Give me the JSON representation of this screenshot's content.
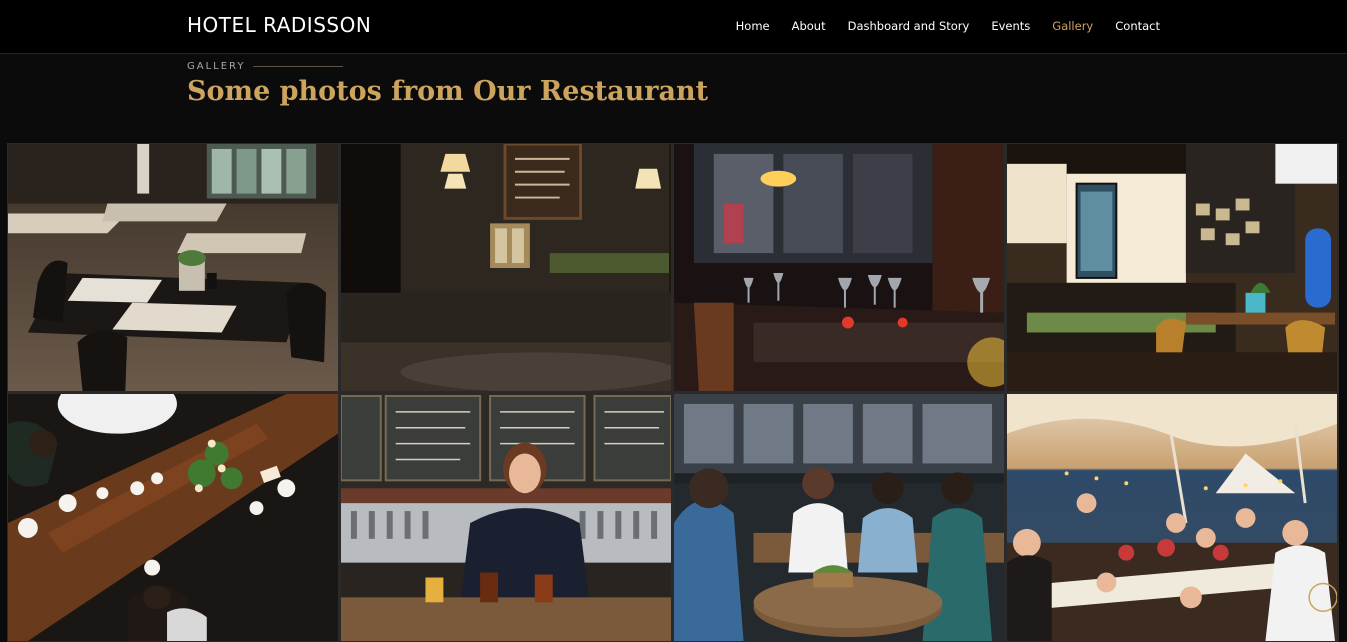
{
  "header": {
    "brand": "HOTEL RADISSON",
    "nav": [
      {
        "label": "Home"
      },
      {
        "label": "About"
      },
      {
        "label": "Dashboard and Story"
      },
      {
        "label": "Events"
      },
      {
        "label": "Gallery"
      },
      {
        "label": "Contact"
      }
    ],
    "active_nav": "Gallery"
  },
  "gallery": {
    "section_label": "GALLERY",
    "title": "Some photos from Our Restaurant",
    "photos": [
      {
        "subject": "empty restaurant tables"
      },
      {
        "subject": "dim bar interior with menu board"
      },
      {
        "subject": "wine glasses on tables at night"
      },
      {
        "subject": "cafe counter with drinks fridge"
      },
      {
        "subject": "overhead wooden dinner table"
      },
      {
        "subject": "smiling woman at beer taps"
      },
      {
        "subject": "friends laughing on patio"
      },
      {
        "subject": "toast under festival tent"
      }
    ]
  },
  "colors": {
    "accent": "#cda45e",
    "background": "#0c0b0b",
    "navbar": "#000000"
  }
}
